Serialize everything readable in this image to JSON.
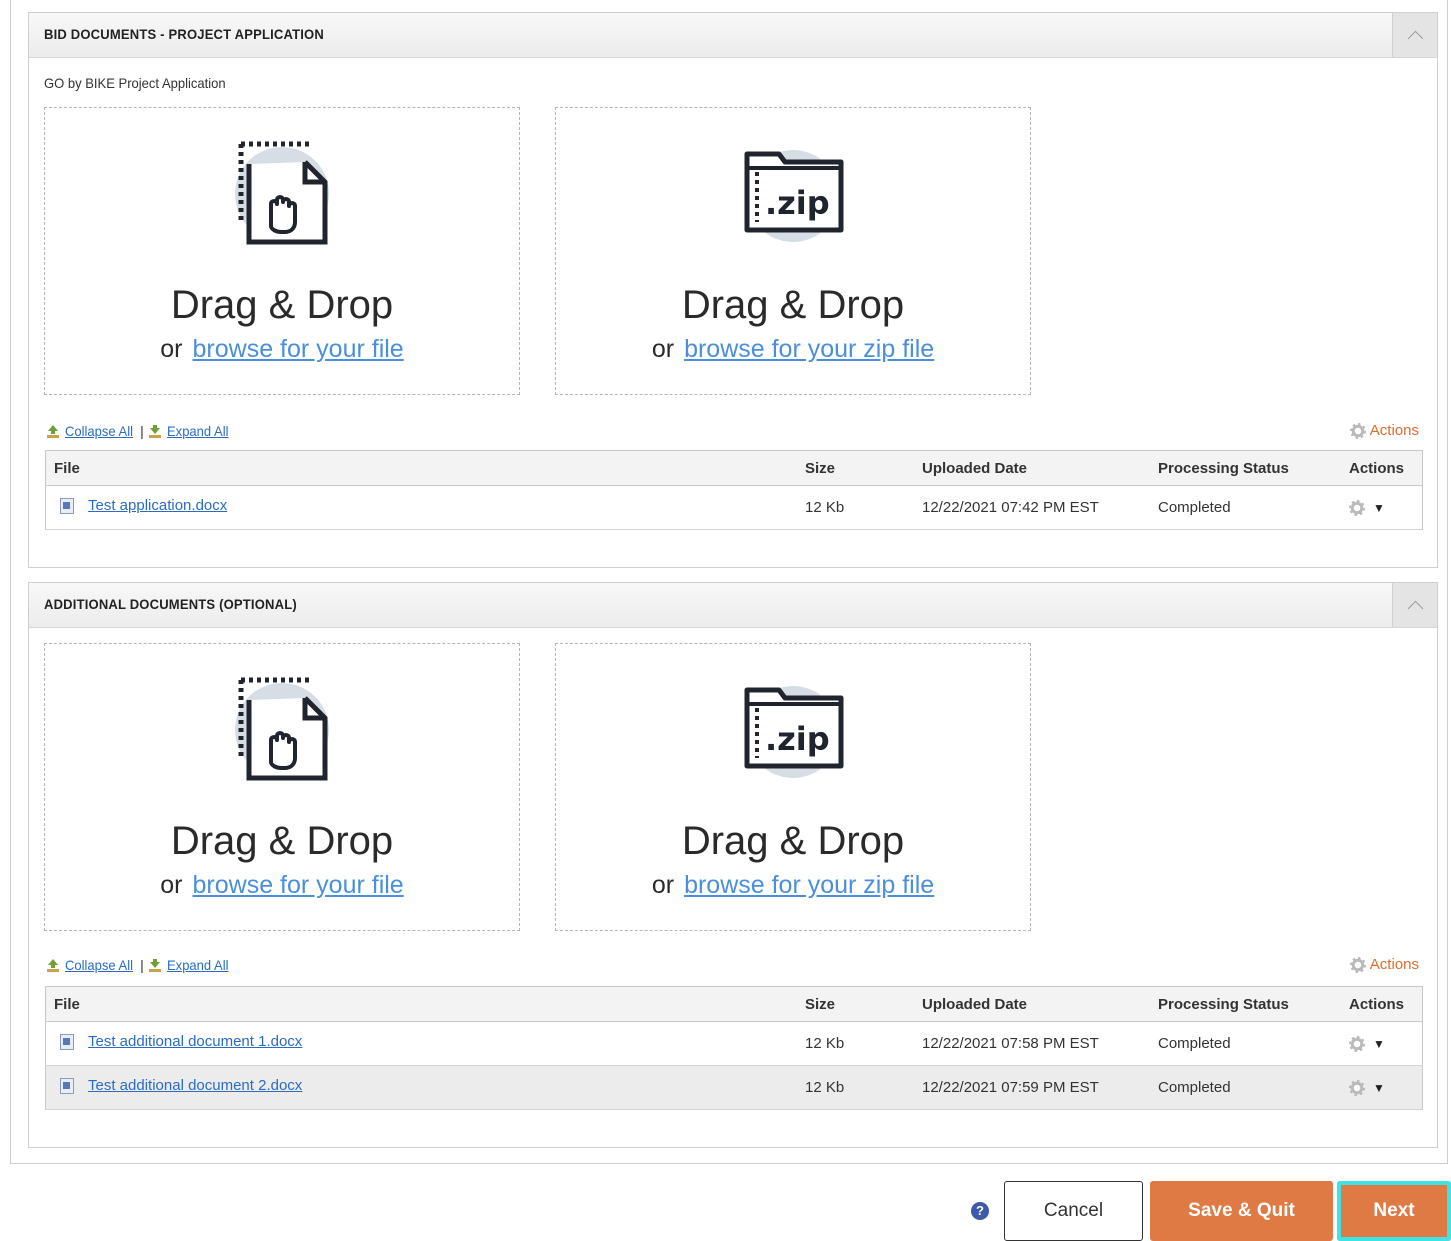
{
  "panels": [
    {
      "title": "BID DOCUMENTS - PROJECT APPLICATION",
      "subtitle": "GO by BIKE Project Application",
      "drop_file": {
        "title": "Drag & Drop",
        "or": "or",
        "link": "browse for your file"
      },
      "drop_zip": {
        "title": "Drag & Drop",
        "or": "or",
        "link": "browse for your zip file"
      },
      "collapse_all": "Collapse All",
      "separator": "|",
      "expand_all": "Expand All",
      "actions_label": "Actions",
      "columns": [
        "File",
        "Size",
        "Uploaded Date",
        "Processing Status",
        "Actions"
      ],
      "rows": [
        {
          "file": "Test application.docx",
          "size": "12 Kb",
          "date": "12/22/2021 07:42 PM EST",
          "status": "Completed"
        }
      ]
    },
    {
      "title": "ADDITIONAL DOCUMENTS (OPTIONAL)",
      "drop_file": {
        "title": "Drag & Drop",
        "or": "or",
        "link": "browse for your file"
      },
      "drop_zip": {
        "title": "Drag & Drop",
        "or": "or",
        "link": "browse for your zip file"
      },
      "collapse_all": "Collapse All",
      "separator": "|",
      "expand_all": "Expand All",
      "actions_label": "Actions",
      "columns": [
        "File",
        "Size",
        "Uploaded Date",
        "Processing Status",
        "Actions"
      ],
      "rows": [
        {
          "file": "Test additional document 1.docx",
          "size": "12 Kb",
          "date": "12/22/2021 07:58 PM EST",
          "status": "Completed"
        },
        {
          "file": "Test additional document 2.docx",
          "size": "12 Kb",
          "date": "12/22/2021 07:59 PM EST",
          "status": "Completed"
        }
      ]
    }
  ],
  "footer": {
    "help_icon": "question-circle-icon",
    "help_glyph": "?",
    "cancel": "Cancel",
    "save_quit": "Save & Quit",
    "next": "Next"
  },
  "icons": {
    "drop_file": "drag-drop-file-icon",
    "drop_zip": "zip-folder-icon",
    "gear": "gear-icon",
    "doc": "docx-file-icon"
  },
  "colors": {
    "accent": "#df7a45",
    "link": "#2a6cc4",
    "focus": "#3fe3e6",
    "actions_link": "#e06c2b"
  }
}
